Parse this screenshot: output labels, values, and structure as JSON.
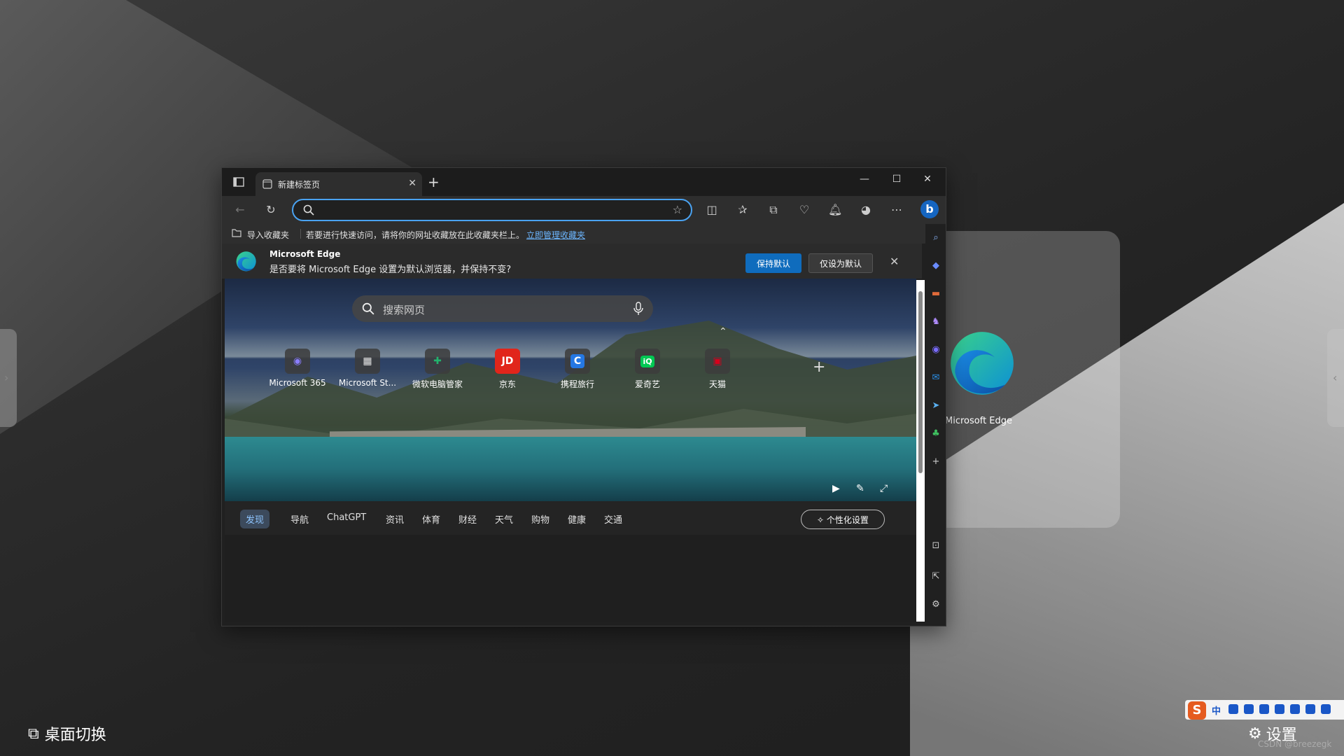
{
  "desktop": {
    "switch_label": "桌面切换",
    "settings_label": "设置",
    "watermark": "CSDN @breezegk",
    "thumbnail_label": "Microsoft Edge",
    "ime_mode": "中"
  },
  "browser": {
    "tab": {
      "title": "新建标签页"
    },
    "address": {
      "value": ""
    },
    "favorites_bar": {
      "import_label": "导入收藏夹",
      "message": "若要进行快速访问，请将你的网址收藏放在此收藏夹栏上。",
      "manage_link": "立即管理收藏夹"
    },
    "infobar": {
      "title": "Microsoft Edge",
      "message": "是否要将 Microsoft Edge 设置为默认浏览器，并保持不变?",
      "keep_default": "保持默认",
      "set_default_only": "仅设为默认"
    },
    "newtab": {
      "search_placeholder": "搜索网页",
      "tiles": [
        {
          "label": "Microsoft 365",
          "icon": "m365-icon",
          "color": "#6b5bd6",
          "glyph": "◉"
        },
        {
          "label": "Microsoft St...",
          "icon": "ms-store-icon",
          "color": "#e8e8e8",
          "glyph": "▦"
        },
        {
          "label": "微软电脑管家",
          "icon": "pc-manager-icon",
          "color": "#23b26d",
          "glyph": "✚"
        },
        {
          "label": "京东",
          "icon": "jd-icon",
          "color": "#e1251b",
          "glyph": "JD"
        },
        {
          "label": "携程旅行",
          "icon": "ctrip-icon",
          "color": "#2577e3",
          "glyph": "C"
        },
        {
          "label": "爱奇艺",
          "icon": "iqiyi-icon",
          "color": "#00c853",
          "glyph": "iQ"
        },
        {
          "label": "天猫",
          "icon": "tmall-icon",
          "color": "#d6001c",
          "glyph": "▣"
        }
      ],
      "feed_tabs": [
        "发现",
        "导航",
        "ChatGPT",
        "资讯",
        "体育",
        "财经",
        "天气",
        "购物",
        "健康",
        "交通"
      ],
      "personalize_label": "个性化设置"
    }
  },
  "colors": {
    "accent": "#0f6cbd",
    "link": "#6cb6ff",
    "active_chip": "#8ec5ff"
  }
}
